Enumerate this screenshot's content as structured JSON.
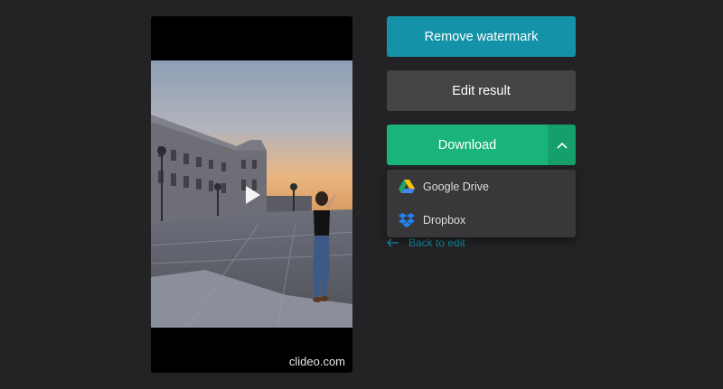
{
  "player": {
    "watermark": "clideo.com",
    "play_icon": "play-icon"
  },
  "actions": {
    "remove_watermark_label": "Remove watermark",
    "edit_result_label": "Edit result",
    "download_label": "Download",
    "toggle_icon": "chevron-up-icon",
    "back_label": "Back to edit",
    "back_icon": "arrow-left-icon"
  },
  "download_menu": {
    "items": [
      {
        "label": "Google Drive",
        "icon": "google-drive-icon"
      },
      {
        "label": "Dropbox",
        "icon": "dropbox-icon"
      }
    ]
  },
  "colors": {
    "background": "#232325",
    "remove_watermark": "#1493a8",
    "edit_result": "#444446",
    "download": "#1ab47a",
    "download_toggle": "#15a06b",
    "back_link": "#168fa3",
    "menu": "#38383a"
  }
}
